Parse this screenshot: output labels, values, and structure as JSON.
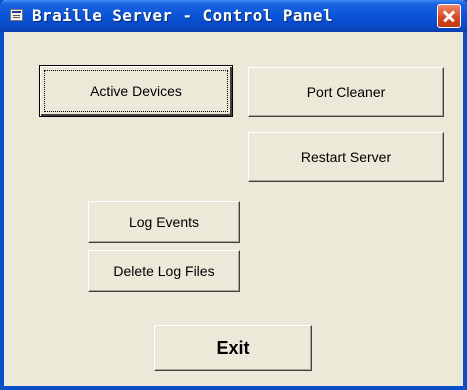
{
  "window": {
    "title": "Braille Server - Control Panel"
  },
  "buttons": {
    "active_devices": "Active Devices",
    "port_cleaner": "Port Cleaner",
    "restart_server": "Restart Server",
    "log_events": "Log Events",
    "delete_log_files": "Delete Log Files",
    "exit": "Exit"
  },
  "icons": {
    "title_icon": "app-window-icon",
    "close": "close-icon"
  },
  "colors": {
    "titlebar": "#0a54d8",
    "window_face": "#ece9d8",
    "close_button": "#d2471f"
  }
}
